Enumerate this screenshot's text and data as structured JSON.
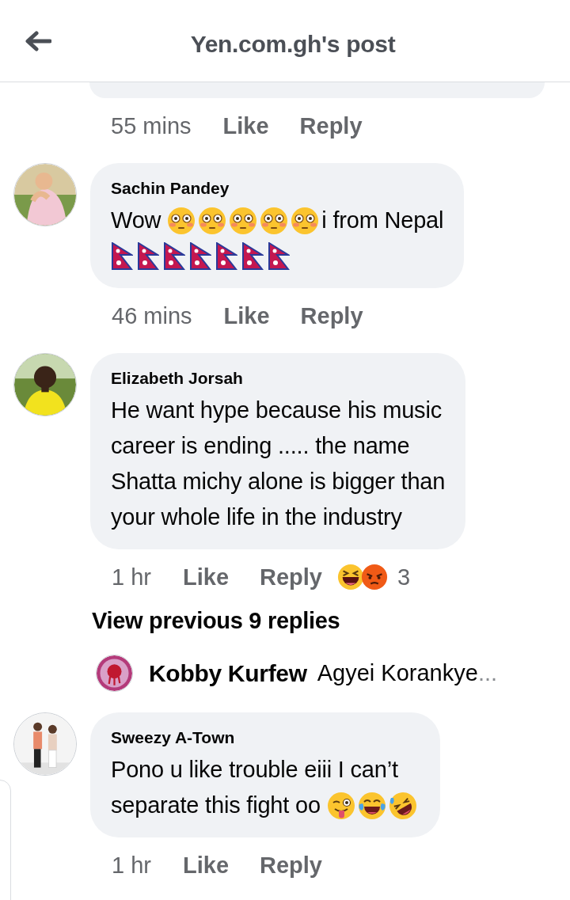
{
  "header": {
    "title": "Yen.com.gh's post"
  },
  "top_comment": {
    "time": "55 mins",
    "actions": [
      "Like",
      "Reply"
    ]
  },
  "comments": [
    {
      "author": "Sachin Pandey",
      "lines": [
        [
          {
            "kind": "text",
            "text": "Wow"
          },
          {
            "kind": "flushed"
          },
          {
            "kind": "flushed"
          },
          {
            "kind": "flushed"
          },
          {
            "kind": "flushed"
          },
          {
            "kind": "flushed"
          },
          {
            "kind": "text",
            "text": "i from Nepal"
          }
        ],
        [
          {
            "kind": "flag"
          },
          {
            "kind": "flag"
          },
          {
            "kind": "flag"
          },
          {
            "kind": "flag"
          },
          {
            "kind": "flag"
          },
          {
            "kind": "flag"
          },
          {
            "kind": "flag"
          }
        ]
      ],
      "time": "46 mins",
      "actions": [
        "Like",
        "Reply"
      ]
    },
    {
      "author": "Elizabeth Jorsah",
      "lines": [
        [
          {
            "kind": "text",
            "text": "He want hype because his music"
          }
        ],
        [
          {
            "kind": "text",
            "text": "career is ending ..... the name"
          }
        ],
        [
          {
            "kind": "text",
            "text": "Shatta michy alone is bigger than"
          }
        ],
        [
          {
            "kind": "text",
            "text": "your whole life in the industry"
          }
        ]
      ],
      "time": "1 hr",
      "actions": [
        "Like",
        "Reply"
      ],
      "reactions": [
        {
          "kind": "haha"
        },
        {
          "kind": "angry"
        }
      ],
      "reaction_count": "3",
      "replies": {
        "link": "View previous 9 replies",
        "latest": {
          "author": "Kobby Kurfew",
          "preview": "Agyei Korankye",
          "ellipsis": "..."
        }
      }
    },
    {
      "author": "Sweezy A-Town",
      "lines": [
        [
          {
            "kind": "text",
            "text": "Pono u like trouble eiii I can’t"
          }
        ],
        [
          {
            "kind": "text",
            "text": "separate this fight oo"
          },
          {
            "kind": "wink"
          },
          {
            "kind": "joy"
          },
          {
            "kind": "rofl"
          }
        ]
      ],
      "time": "1 hr",
      "actions": [
        "Like",
        "Reply"
      ]
    }
  ]
}
